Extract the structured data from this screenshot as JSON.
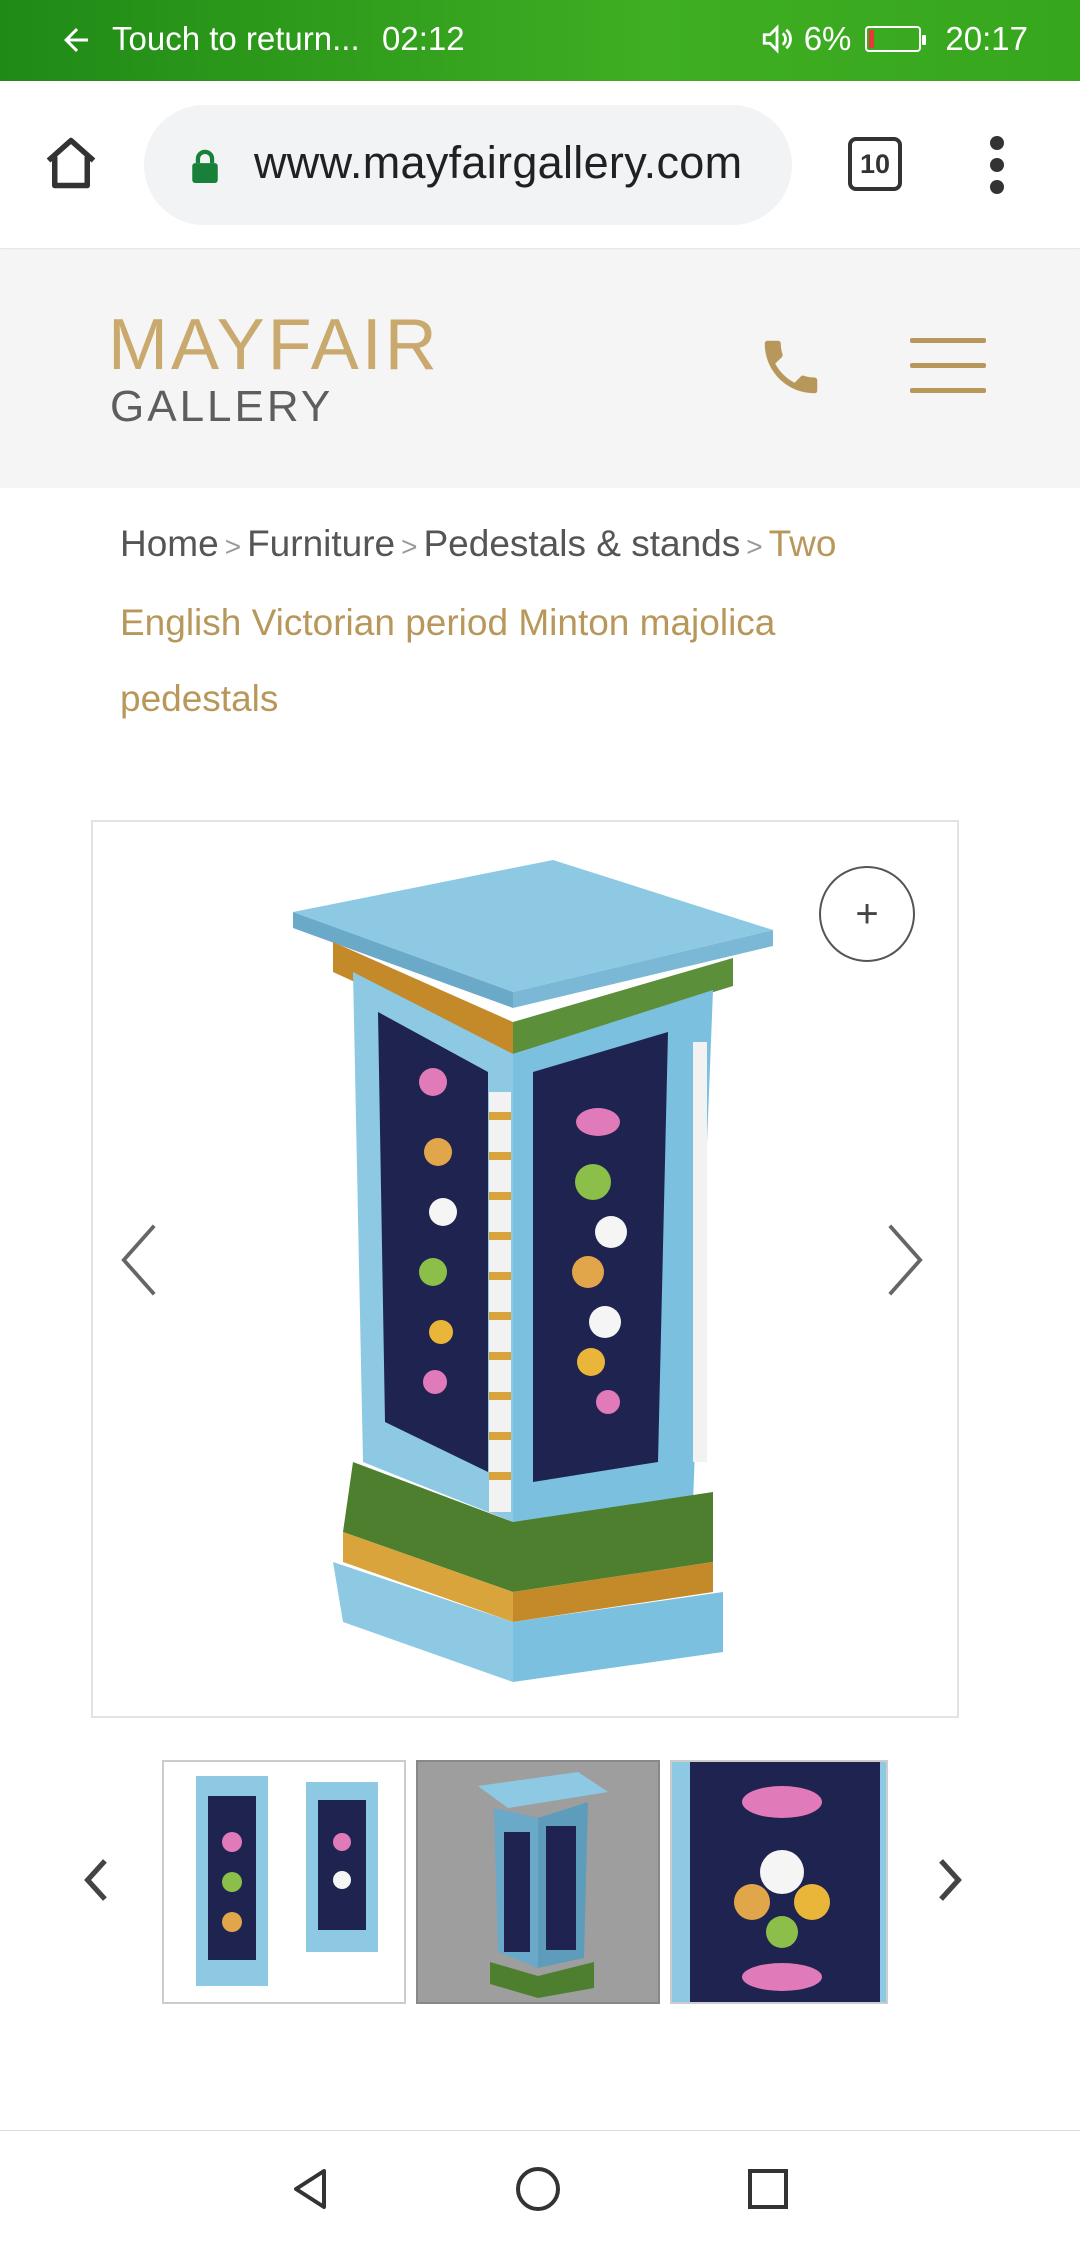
{
  "status_bar": {
    "return_text": "Touch to return...",
    "call_timer": "02:12",
    "battery_percent": "6%",
    "time": "20:17"
  },
  "browser": {
    "url": "www.mayfairgallery.com",
    "tab_count": "10"
  },
  "site_header": {
    "logo_line1": "MAYFAIR",
    "logo_line2": "GALLERY",
    "accent_color": "#b8985a"
  },
  "breadcrumb": {
    "items": [
      "Home",
      "Furniture",
      "Pedestals & stands"
    ],
    "separator": ">",
    "current": "Two English Victorian period Minton majolica pedestals"
  },
  "gallery": {
    "zoom_label": "+",
    "thumbnail_count": 3,
    "selected_thumbnail": 2
  },
  "icons": {
    "back": "arrow-left-icon",
    "home": "home-icon",
    "lock": "lock-icon",
    "menu": "kebab-menu-icon",
    "phone": "phone-icon",
    "hamburger": "hamburger-icon"
  }
}
